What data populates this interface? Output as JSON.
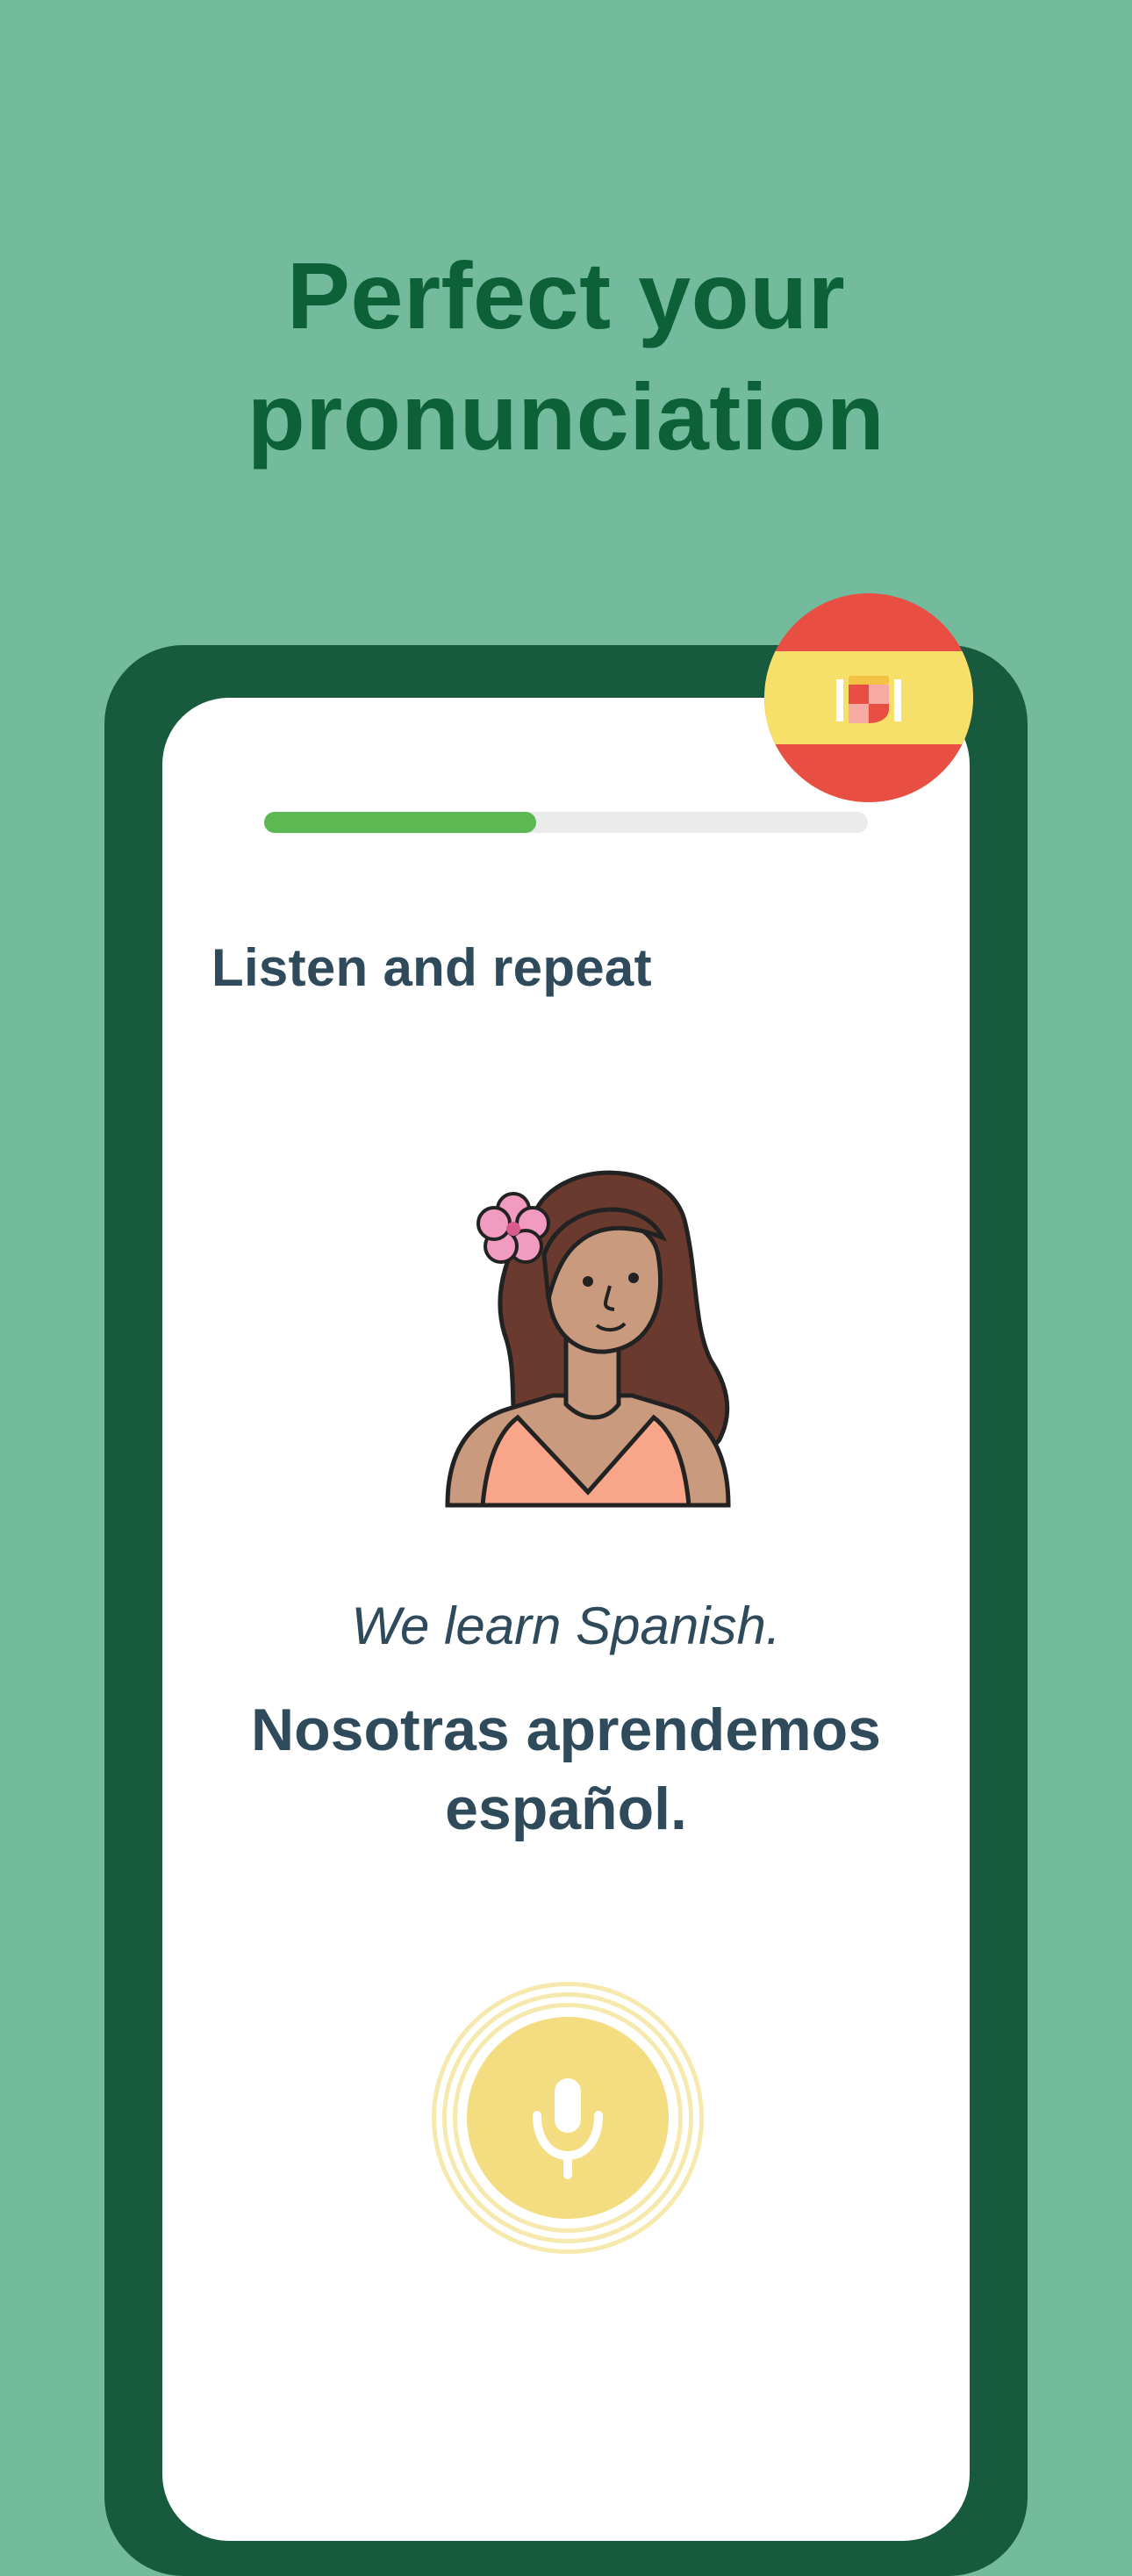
{
  "headline": {
    "line1": "Perfect your",
    "line2": "pronunciation"
  },
  "lesson": {
    "language_flag_icon": "spain-flag-icon",
    "progress_fraction": 0.45,
    "instruction": "Listen and repeat",
    "speaker_icon": "woman-avatar-illustration",
    "translation": "We learn Spanish.",
    "phrase_line1": "Nosotras aprendemos",
    "phrase_line2": "español.",
    "mic_icon": "microphone-icon"
  },
  "colors": {
    "background": "#74ba9d",
    "headline": "#0c6138",
    "device_frame": "#175a3e",
    "progress": "#5cb853",
    "text": "#2e4a5b",
    "mic": "#f3dd80"
  }
}
